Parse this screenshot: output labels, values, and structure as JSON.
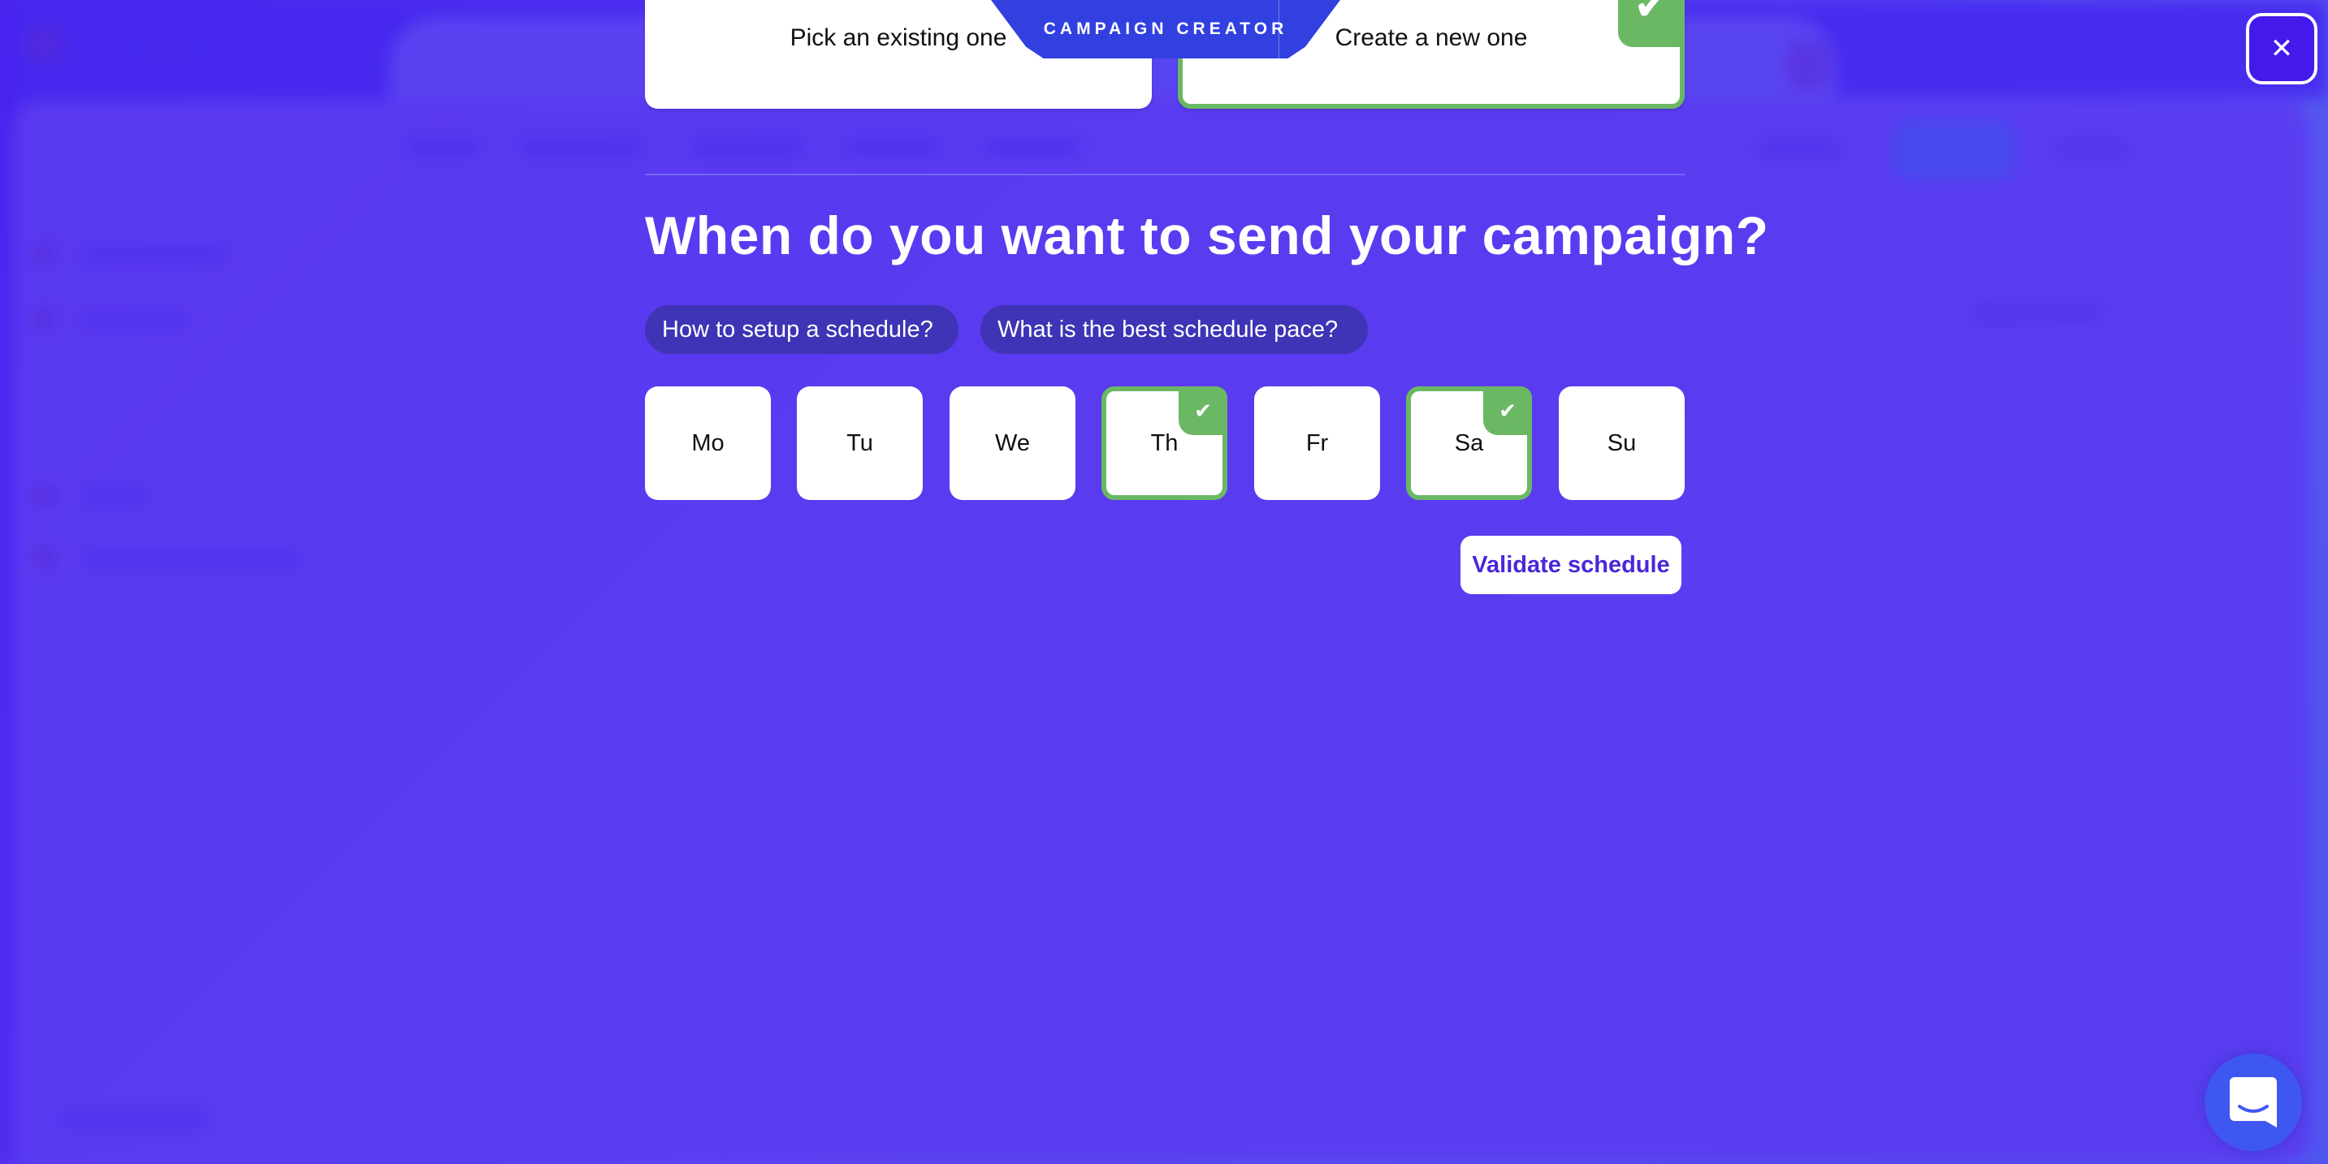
{
  "modal": {
    "tab_label": "CAMPAIGN CREATOR",
    "close_icon": "close-icon",
    "close_glyph": "✕"
  },
  "choice": {
    "options": [
      {
        "label": "Pick an existing one",
        "selected": false
      },
      {
        "label": "Create a new one",
        "selected": true
      }
    ],
    "check_glyph": "✔"
  },
  "schedule": {
    "heading": "When do you want to send your campaign?",
    "help_links": [
      {
        "label": "How to setup a schedule?"
      },
      {
        "label": "What is the best schedule pace?"
      }
    ],
    "days": [
      {
        "label": "Mo",
        "selected": false
      },
      {
        "label": "Tu",
        "selected": false
      },
      {
        "label": "We",
        "selected": false
      },
      {
        "label": "Th",
        "selected": true
      },
      {
        "label": "Fr",
        "selected": false
      },
      {
        "label": "Sa",
        "selected": true
      },
      {
        "label": "Su",
        "selected": false
      }
    ],
    "check_glyph": "✔",
    "validate_label": "Validate schedule"
  },
  "chat_widget": {
    "icon": "chat-bubble-icon"
  },
  "colors": {
    "selected_border": "#6bb864",
    "pill_bg": "#3e34b5",
    "accent_text": "#4a26d8",
    "close_bg": "#4419ec",
    "tab_bg": "#3140df"
  }
}
